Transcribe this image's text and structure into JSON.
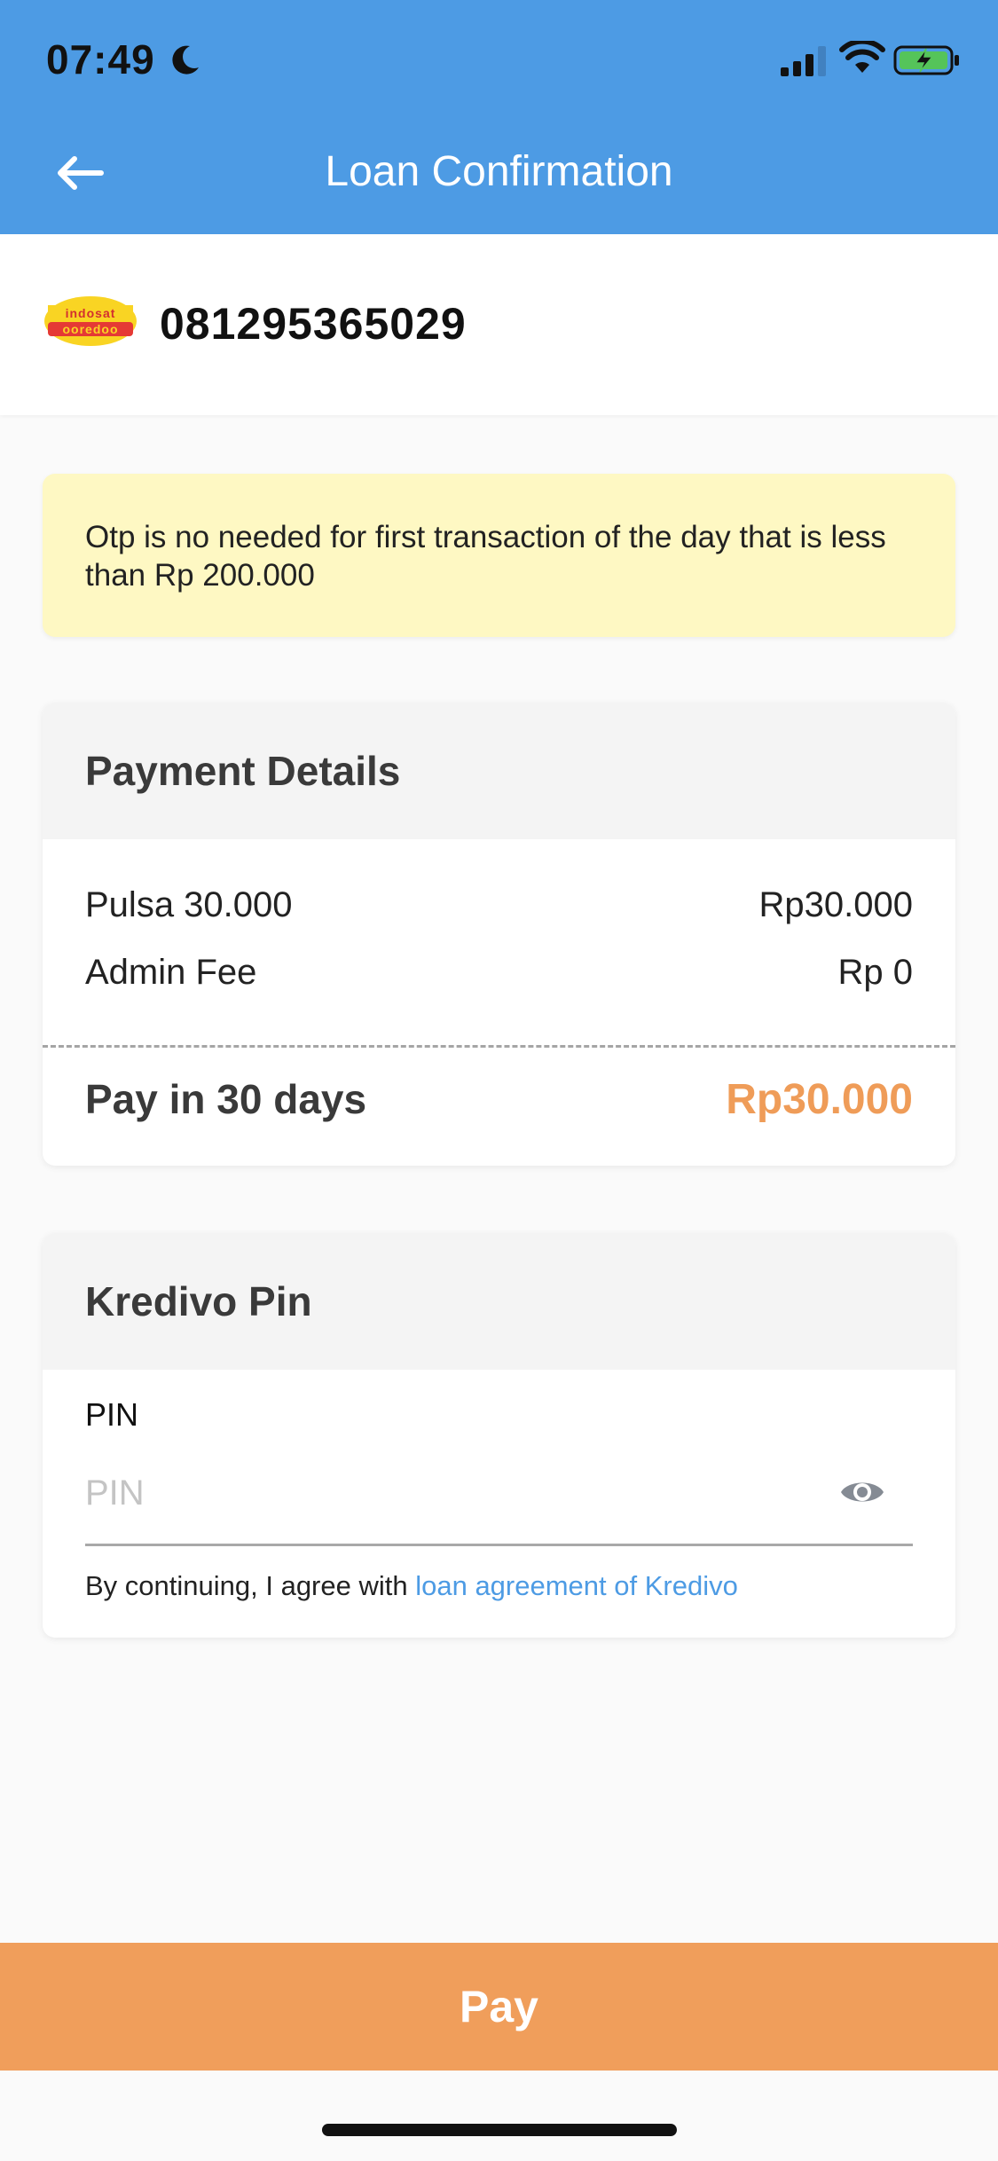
{
  "status_bar": {
    "time": "07:49",
    "icons": [
      "moon-icon",
      "signal-icon",
      "wifi-icon",
      "battery-charging-icon"
    ]
  },
  "header": {
    "title": "Loan Confirmation",
    "back_icon": "arrow-left-icon",
    "background": "#4d9be4"
  },
  "account": {
    "operator_logo": "indosat ooredoo",
    "phone_number": "081295365029"
  },
  "notice": {
    "text": "Otp is no needed for first transaction of the day that is less than Rp 200.000",
    "background": "#fef8c3"
  },
  "payment_details": {
    "title": "Payment Details",
    "rows": [
      {
        "label": "Pulsa 30.000",
        "value": "Rp30.000"
      },
      {
        "label": "Admin Fee",
        "value": "Rp 0"
      }
    ],
    "total_label": "Pay in 30 days",
    "total_value": "Rp30.000",
    "accent": "#ef9c58"
  },
  "pin": {
    "title": "Kredivo Pin",
    "label": "PIN",
    "placeholder": "PIN",
    "value": "",
    "toggle_icon": "eye-icon",
    "agreement_prefix": "By continuing, I agree with ",
    "agreement_link": "loan agreement of Kredivo"
  },
  "pay_button": {
    "label": "Pay",
    "color": "#f09e5b"
  }
}
